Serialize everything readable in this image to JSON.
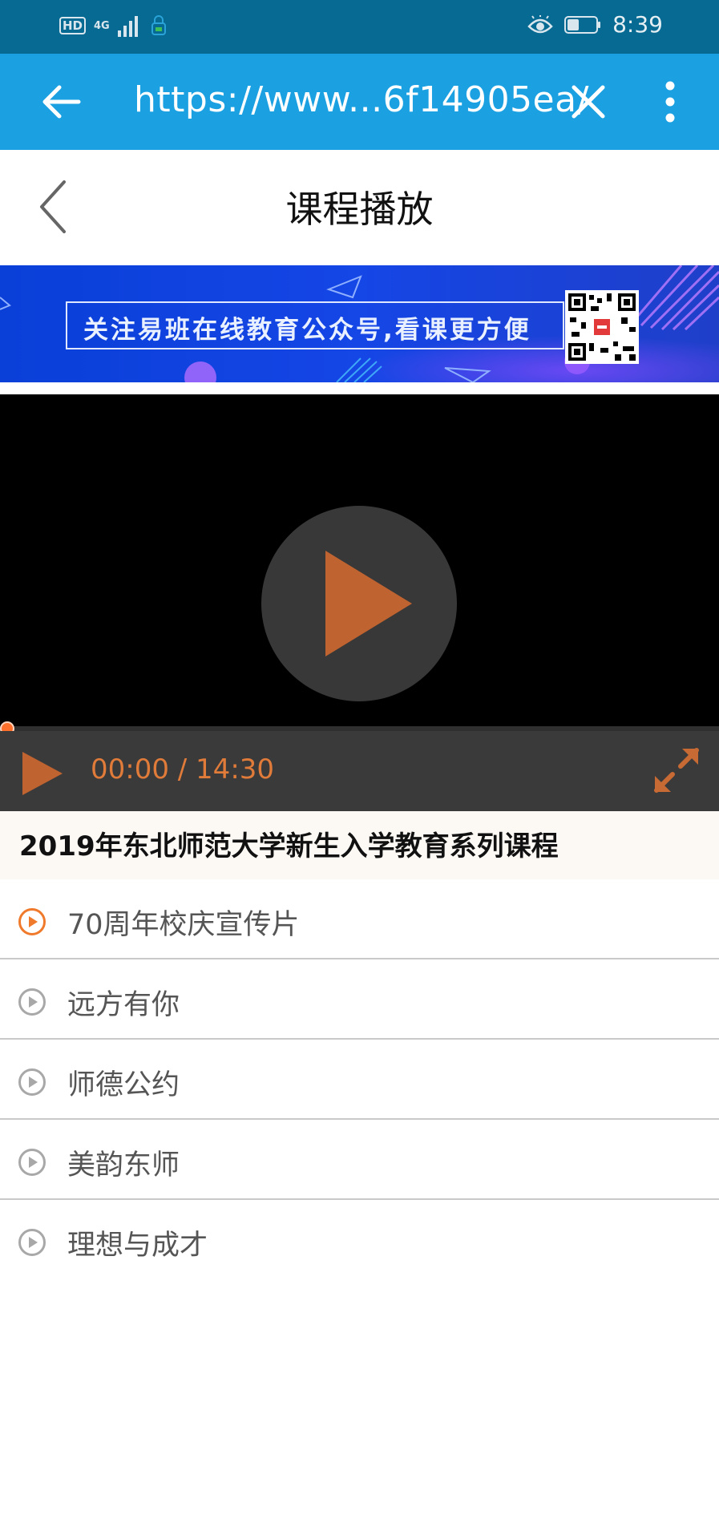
{
  "status_bar": {
    "hd": "HD",
    "network": "4G",
    "time": "8:39"
  },
  "browser": {
    "url": "https://www...6f14905ea/"
  },
  "header": {
    "title": "课程播放"
  },
  "banner": {
    "text": "关注易班在线教育公众号,看课更方便"
  },
  "player": {
    "time": "00:00 / 14:30",
    "progress": 0
  },
  "course": {
    "title": "2019年东北师范大学新生入学教育系列课程"
  },
  "lessons": [
    {
      "label": "70周年校庆宣传片",
      "active": true
    },
    {
      "label": "远方有你",
      "active": false
    },
    {
      "label": "师德公约",
      "active": false
    },
    {
      "label": "美韵东师",
      "active": false
    },
    {
      "label": "理想与成才",
      "active": false
    }
  ],
  "colors": {
    "accent": "#e07b3a",
    "browser_bar": "#1ba0e2",
    "status_bar": "#066a92"
  }
}
